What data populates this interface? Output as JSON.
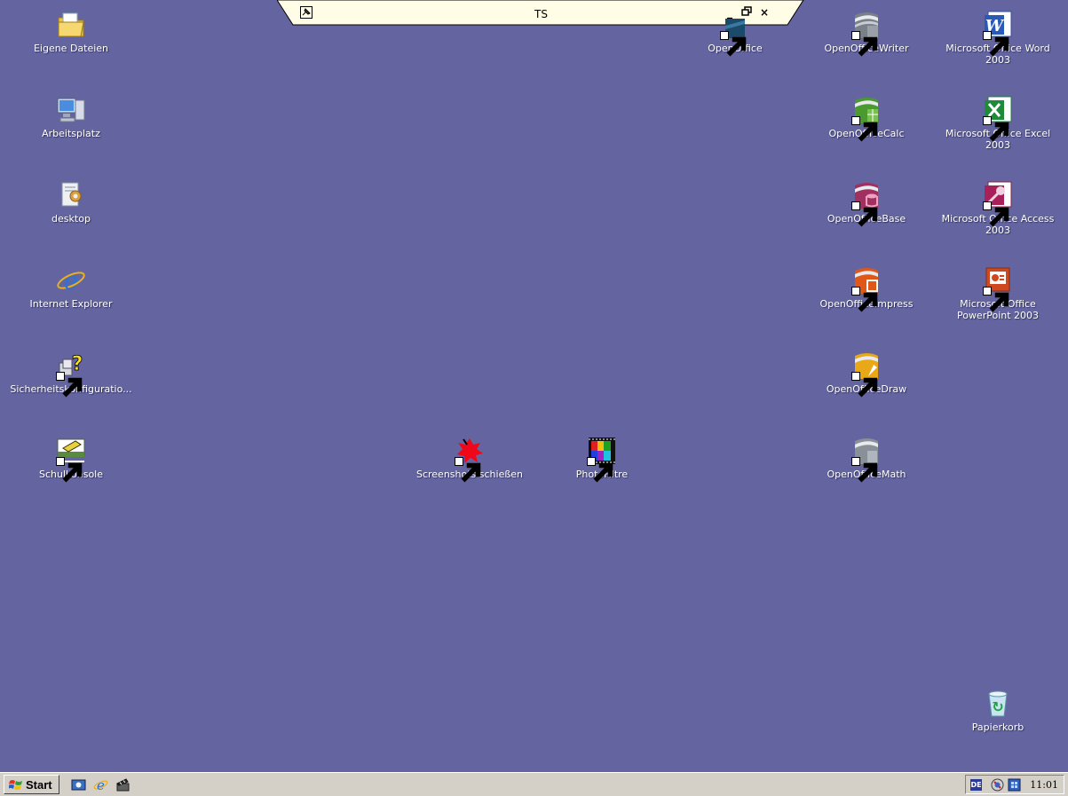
{
  "desktop": {
    "background_color": "#6464a0",
    "left_icons": [
      {
        "label": "Eigene Dateien",
        "icon": "folder-documents-icon"
      },
      {
        "label": "Arbeitsplatz",
        "icon": "my-computer-icon"
      },
      {
        "label": "desktop",
        "icon": "desktop-folder-icon"
      },
      {
        "label": "Internet Explorer",
        "icon": "internet-explorer-icon"
      },
      {
        "label": "Sicherheitskonfiguratio...",
        "icon": "security-config-icon"
      },
      {
        "label": "Schulkonsole",
        "icon": "school-console-icon"
      }
    ],
    "middle_icons": [
      {
        "label": "Screenshots schießen",
        "icon": "screenshot-tool-icon"
      },
      {
        "label": "PhotoFiltre",
        "icon": "photofiltre-icon"
      }
    ],
    "openoffice_icons": [
      {
        "label": "OpenOffice",
        "icon": "openoffice-icon"
      },
      {
        "label": "OpenOfficeWriter",
        "icon": "openoffice-writer-icon"
      },
      {
        "label": "OpenOfficeCalc",
        "icon": "openoffice-calc-icon"
      },
      {
        "label": "OpenOfficeBase",
        "icon": "openoffice-base-icon"
      },
      {
        "label": "OpenOfficeImpress",
        "icon": "openoffice-impress-icon"
      },
      {
        "label": "OpenOfficeDraw",
        "icon": "openoffice-draw-icon"
      },
      {
        "label": "OpenOfficeMath",
        "icon": "openoffice-math-icon"
      }
    ],
    "ms_office_icons": [
      {
        "label": "Microsoft Office Word 2003",
        "icon": "ms-word-icon"
      },
      {
        "label": "Microsoft Office Excel 2003",
        "icon": "ms-excel-icon"
      },
      {
        "label": "Microsoft Office Access 2003",
        "icon": "ms-access-icon"
      },
      {
        "label": "Microsoft Office PowerPoint 2003",
        "icon": "ms-powerpoint-icon"
      }
    ],
    "recycle_bin": {
      "label": "Papierkorb",
      "icon": "recycle-bin-icon"
    }
  },
  "connection_bar": {
    "title": "TS",
    "minimize_label": "_",
    "restore_label": "🗗",
    "close_label": "×"
  },
  "taskbar": {
    "start_label": "Start",
    "language": "DE",
    "clock": "11:01"
  }
}
